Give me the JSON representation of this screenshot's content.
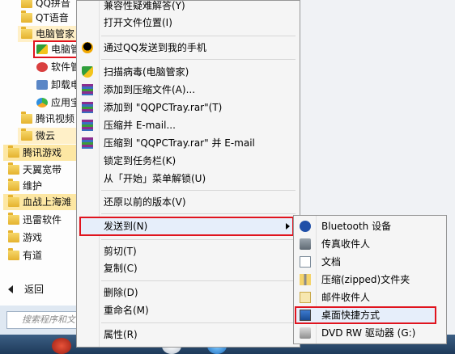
{
  "start_menu": {
    "items": [
      {
        "label": "QQ拼音",
        "indent": 2
      },
      {
        "label": "QT语音",
        "indent": 2
      },
      {
        "label": "电脑管家",
        "indent": 2
      },
      {
        "label": "电脑管家",
        "indent": 3
      },
      {
        "label": "软件管理",
        "indent": 3
      },
      {
        "label": "卸载电脑管家",
        "indent": 3
      },
      {
        "label": "应用宝",
        "indent": 3
      },
      {
        "label": "腾讯视频",
        "indent": 2
      },
      {
        "label": "微云",
        "indent": 2
      },
      {
        "label": "腾讯游戏",
        "indent": 1
      },
      {
        "label": "天翼宽带",
        "indent": 1
      },
      {
        "label": "维护",
        "indent": 1
      },
      {
        "label": "血战上海滩",
        "indent": 1
      },
      {
        "label": "迅雷软件",
        "indent": 1
      },
      {
        "label": "游戏",
        "indent": 1
      },
      {
        "label": "有道",
        "indent": 1
      }
    ],
    "back_label": "返回",
    "search_placeholder": "搜索程序和文件"
  },
  "context_menu": {
    "items": [
      {
        "label": "兼容性疑难解答(Y)",
        "icon": "none"
      },
      {
        "label": "打开文件位置(I)",
        "icon": "none"
      },
      {
        "label": "通过QQ发送到我的手机",
        "icon": "qq-penguin-icon"
      },
      {
        "label": "扫描病毒(电脑管家)",
        "icon": "shield-icon"
      },
      {
        "label": "添加到压缩文件(A)...",
        "icon": "winrar-icon"
      },
      {
        "label": "添加到 \"QQPCTray.rar\"(T)",
        "icon": "winrar-icon"
      },
      {
        "label": "压缩并 E-mail...",
        "icon": "winrar-icon"
      },
      {
        "label": "压缩到 \"QQPCTray.rar\" 并 E-mail",
        "icon": "winrar-icon"
      },
      {
        "label": "锁定到任务栏(K)",
        "icon": "none"
      },
      {
        "label": "从「开始」菜单解锁(U)",
        "icon": "none"
      },
      {
        "label": "还原以前的版本(V)",
        "icon": "none"
      },
      {
        "label": "发送到(N)",
        "icon": "none"
      },
      {
        "label": "剪切(T)",
        "icon": "none"
      },
      {
        "label": "复制(C)",
        "icon": "none"
      },
      {
        "label": "删除(D)",
        "icon": "none"
      },
      {
        "label": "重命名(M)",
        "icon": "none"
      },
      {
        "label": "属性(R)",
        "icon": "none"
      }
    ]
  },
  "send_to_menu": {
    "items": [
      {
        "label": "Bluetooth 设备",
        "icon": "bluetooth-icon"
      },
      {
        "label": "传真收件人",
        "icon": "fax-icon"
      },
      {
        "label": "文档",
        "icon": "document-icon"
      },
      {
        "label": "压缩(zipped)文件夹",
        "icon": "zip-folder-icon"
      },
      {
        "label": "邮件收件人",
        "icon": "mail-icon"
      },
      {
        "label": "桌面快捷方式",
        "icon": "desktop-icon"
      },
      {
        "label": "DVD RW 驱动器 (G:)",
        "icon": "dvd-drive-icon"
      }
    ]
  },
  "colors": {
    "highlight_border": "#e0141e",
    "menu_bg": "#f5f5f5",
    "taskbar": "#1e3a5a"
  }
}
